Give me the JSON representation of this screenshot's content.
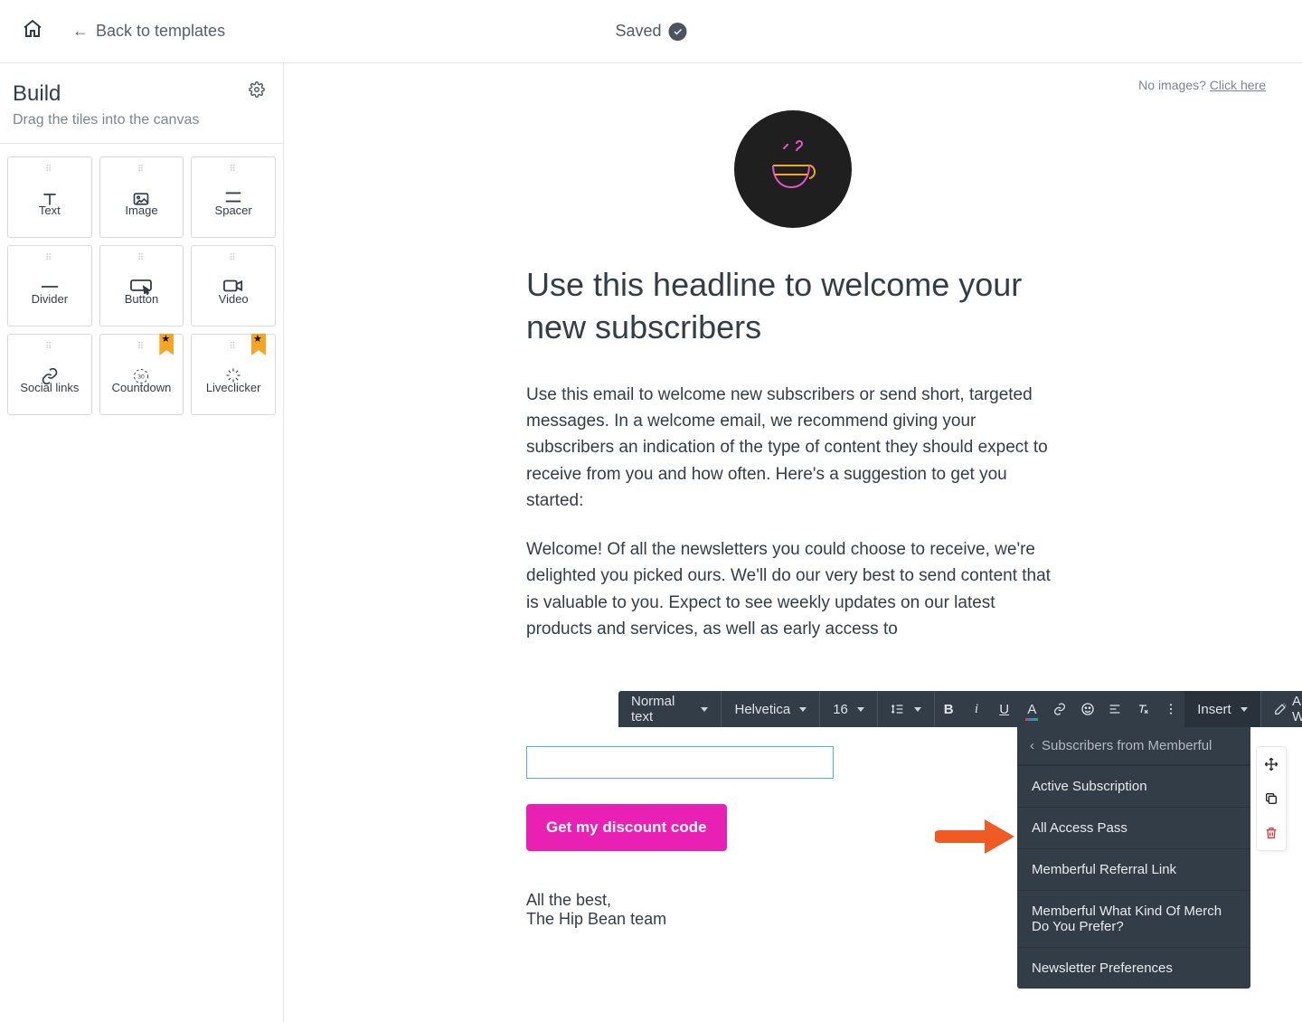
{
  "header": {
    "back_label": "Back to templates",
    "saved_label": "Saved"
  },
  "sidebar": {
    "title": "Build",
    "subtitle": "Drag the tiles into the canvas",
    "tiles": [
      {
        "label": "Text"
      },
      {
        "label": "Image"
      },
      {
        "label": "Spacer"
      },
      {
        "label": "Divider"
      },
      {
        "label": "Button"
      },
      {
        "label": "Video"
      },
      {
        "label": "Social links"
      },
      {
        "label": "Countdown"
      },
      {
        "label": "Liveclicker"
      }
    ]
  },
  "canvas": {
    "no_images_text": "No images? ",
    "no_images_link": "Click here",
    "headline": "Use this headline to welcome your new subscribers",
    "para1": "Use this email to welcome new subscribers or send short, targeted messages. In a welcome email, we recommend giving your subscribers an indication of the type of content they should expect to receive from you and how often. Here's a suggestion to get you started:",
    "para2": "Welcome! Of all the newsletters you could choose to receive, we're delighted you picked ours. We'll do our very best to send content that is valuable to you. Expect to see weekly updates on our latest products and services, as well as early access to",
    "cta_label": "Get my discount code",
    "sig1": "All the best,",
    "sig2": "The Hip Bean team"
  },
  "toolbar": {
    "style_label": "Normal text",
    "font_label": "Helvetica",
    "size_label": "16",
    "insert_label": "Insert",
    "ai_label": "AI Writer"
  },
  "dropdown": {
    "header": "Subscribers from Memberful",
    "items": [
      "Active Subscription",
      "All Access Pass",
      "Memberful Referral Link",
      "Memberful What Kind Of Merch Do You Prefer?",
      "Newsletter Preferences"
    ]
  }
}
